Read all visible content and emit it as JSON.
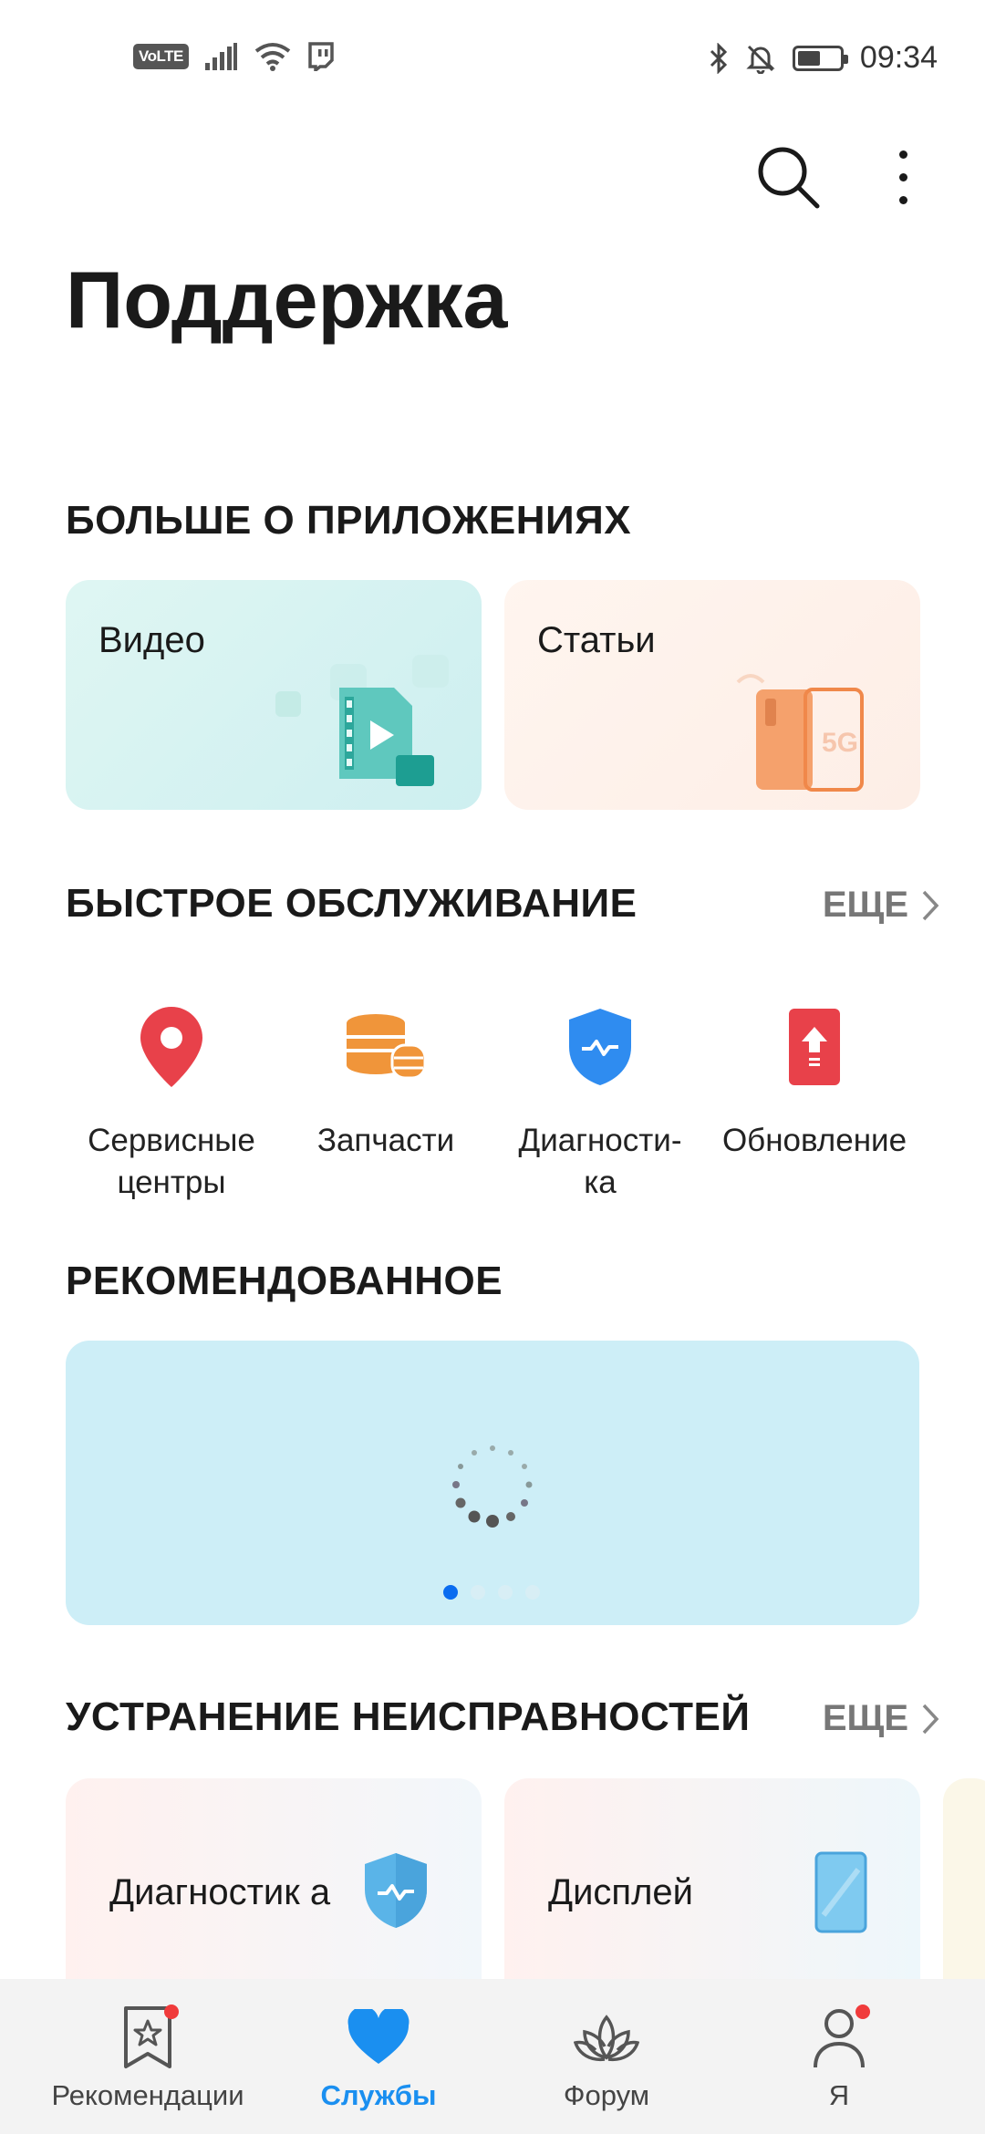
{
  "status_bar": {
    "volte": "VoLTE",
    "time": "09:34",
    "battery_level": 0.55,
    "icons": [
      "signal-icon",
      "wifi-icon",
      "twitch-icon",
      "bluetooth-icon",
      "mute-bell-icon",
      "battery-icon"
    ]
  },
  "header": {
    "title": "Поддержка",
    "actions": [
      "search-icon",
      "more-vertical-icon"
    ]
  },
  "apps_section": {
    "title": "БОЛЬШЕ О ПРИЛОЖЕНИЯХ",
    "cards": [
      {
        "label": "Видео",
        "icon": "video-folder-icon"
      },
      {
        "label": "Статьи",
        "icon": "phone-5g-icon"
      }
    ]
  },
  "quick_section": {
    "title": "БЫСТРОЕ ОБСЛУЖИВАНИЕ",
    "more": "ЕЩЕ",
    "items": [
      {
        "label": "Сервисные центры",
        "icon": "location-pin-icon",
        "color": "#e8414a"
      },
      {
        "label": "Запчасти",
        "icon": "coins-stack-icon",
        "color": "#f0953a"
      },
      {
        "label": "Диагности-ка",
        "icon": "shield-icon",
        "color": "#2f8cf0"
      },
      {
        "label": "Обновление",
        "icon": "update-arrow-icon",
        "color": "#e8414a"
      }
    ]
  },
  "recommended_section": {
    "title": "РЕКОМЕНДОВАННОЕ",
    "slides": 4,
    "active_slide": 1
  },
  "trouble_section": {
    "title": "УСТРАНЕНИЕ НЕИСПРАВНОСТЕЙ",
    "more": "ЕЩЕ",
    "cards": [
      {
        "label": "Диагностик а",
        "icon": "shield-icon"
      },
      {
        "label": "Дисплей",
        "icon": "phone-display-icon"
      }
    ]
  },
  "bottom_nav": {
    "items": [
      {
        "label": "Рекомендации",
        "icon": "bookmark-star-icon",
        "badge": true
      },
      {
        "label": "Службы",
        "icon": "heart-icon",
        "active": true
      },
      {
        "label": "Форум",
        "icon": "lotus-icon"
      },
      {
        "label": "Я",
        "icon": "person-icon",
        "badge": true
      }
    ]
  },
  "colors": {
    "accent": "#1a8ff0",
    "badge": "#f03b3b",
    "banner": "#cdeef7"
  }
}
